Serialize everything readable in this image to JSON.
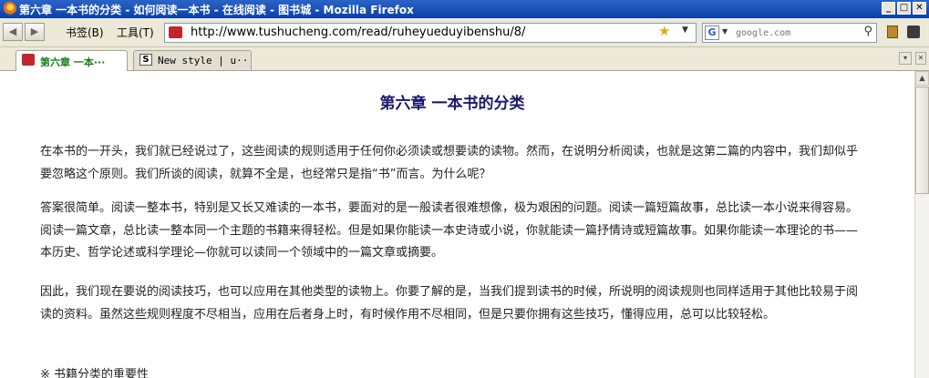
{
  "window": {
    "title": "第六章 一本书的分类 - 如何阅读一本书 - 在线阅读 - 图书城 - Mozilla Firefox",
    "controls": {
      "minimize": "_",
      "maximize": "□",
      "close": "✕"
    }
  },
  "toolbar": {
    "back": "◀",
    "forward": "▶",
    "bookmarks_menu": "书签(B)",
    "tools_menu": "工具(T)",
    "url": "http://www.tushucheng.com/read/ruheyueduyibenshu/8/",
    "bookmark_star": "★",
    "search": {
      "engine": "G",
      "placeholder": "google.com",
      "search_icon": "⚲"
    }
  },
  "tabs": [
    {
      "label": "第六章 一本···",
      "active": true
    },
    {
      "label": "New style | u···",
      "active": false
    }
  ],
  "article": {
    "title": "第六章 一本书的分类",
    "paragraphs": [
      "在本书的一开头，我们就已经说过了，这些阅读的规则适用于任何你必须读或想要读的读物。然而，在说明分析阅读，也就是这第二篇的内容中，我们却似乎要忽略这个原则。我们所谈的阅读，就算不全是，也经常只是指“书”而言。为什么呢？",
      "答案很简单。阅读一整本书，特别是又长又难读的一本书，要面对的是一般读者很难想像，极为艰困的问题。阅读一篇短篇故事，总比读一本小说来得容易。阅读一篇文章，总比读一整本同一个主题的书籍来得轻松。但是如果你能读一本史诗或小说，你就能读一篇抒情诗或短篇故事。如果你能读一本理论的书——本历史、哲学论述或科学理论—你就可以读同一个领域中的一篇文章或摘要。",
      "因此，我们现在要说的阅读技巧，也可以应用在其他类型的读物上。你要了解的是，当我们提到读书的时候，所说明的阅读规则也同样适用于其他比较易于阅读的资料。虽然这些规则程度不尽相当，应用在后者身上时，有时候作用不尽相同，但是只要你拥有这些技巧，懂得应用，总可以比较轻松。"
    ],
    "section_heading": "※ 书籍分类的重要性"
  },
  "icons": {
    "page_favicon": "red-book-icon",
    "tab2_favicon": "s-logo-icon"
  }
}
